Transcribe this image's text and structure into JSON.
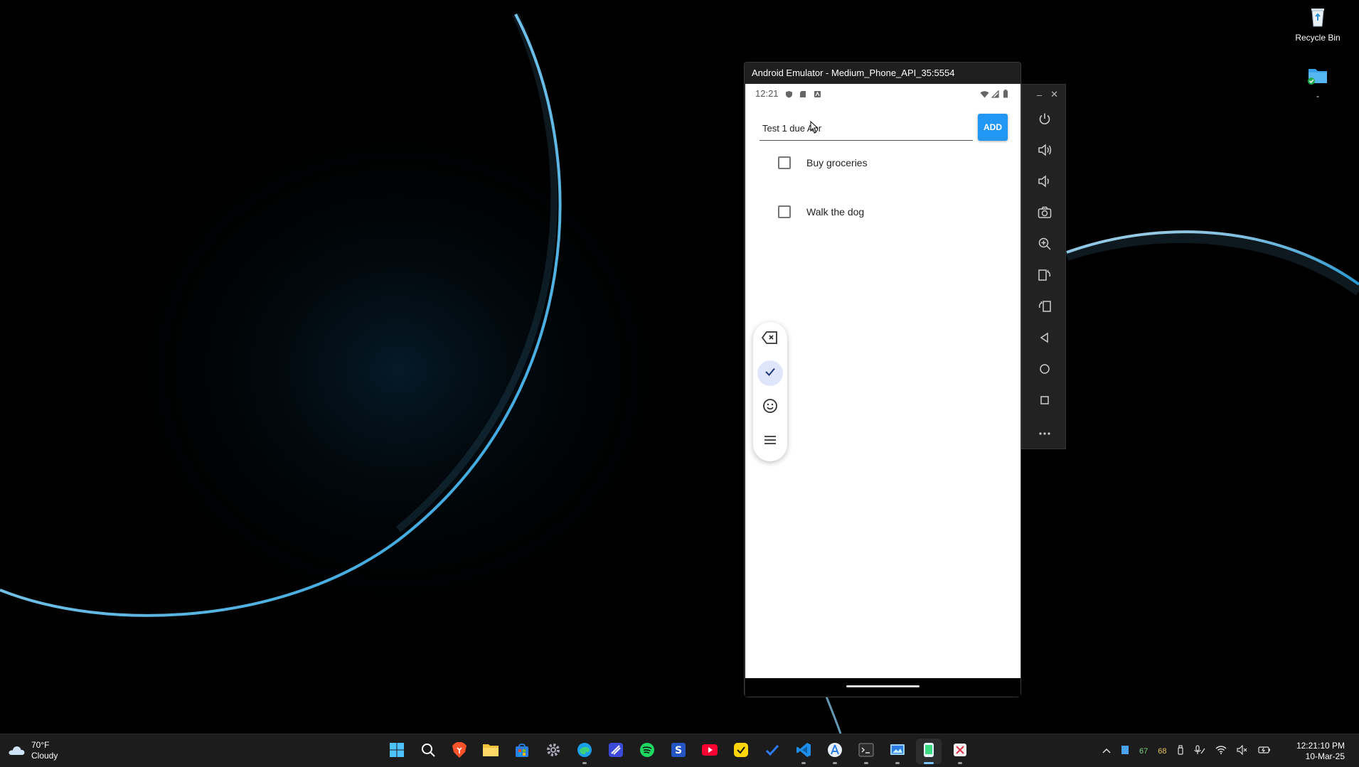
{
  "desktop": {
    "icons": [
      {
        "label": "Recycle Bin",
        "icon": "recycle-bin-icon"
      },
      {
        "label": "-",
        "icon": "folder-sync-icon"
      }
    ]
  },
  "emulator": {
    "title": "Android Emulator - Medium_Phone_API_35:5554",
    "status_bar": {
      "time": "12:21"
    },
    "app": {
      "input": {
        "value": "Test 1 due Apr"
      },
      "add_label": "ADD",
      "tasks": [
        {
          "label": "Buy groceries",
          "checked": false
        },
        {
          "label": "Walk the dog",
          "checked": false
        }
      ]
    },
    "keyboard_toolbar": [
      "backspace-icon",
      "check-icon",
      "emoji-icon",
      "menu-icon"
    ],
    "side_toolbar": [
      "power-icon",
      "volume-up-icon",
      "volume-down-icon",
      "camera-icon",
      "zoom-icon",
      "rotate-left-icon",
      "rotate-right-icon",
      "back-icon",
      "home-icon",
      "overview-icon",
      "more-icon"
    ]
  },
  "taskbar": {
    "weather": {
      "temp": "70°F",
      "condition": "Cloudy"
    },
    "tray": {
      "num1": "67",
      "num2": "68"
    },
    "clock": {
      "time": "12:21:10 PM",
      "date": "10-Mar-25"
    }
  }
}
